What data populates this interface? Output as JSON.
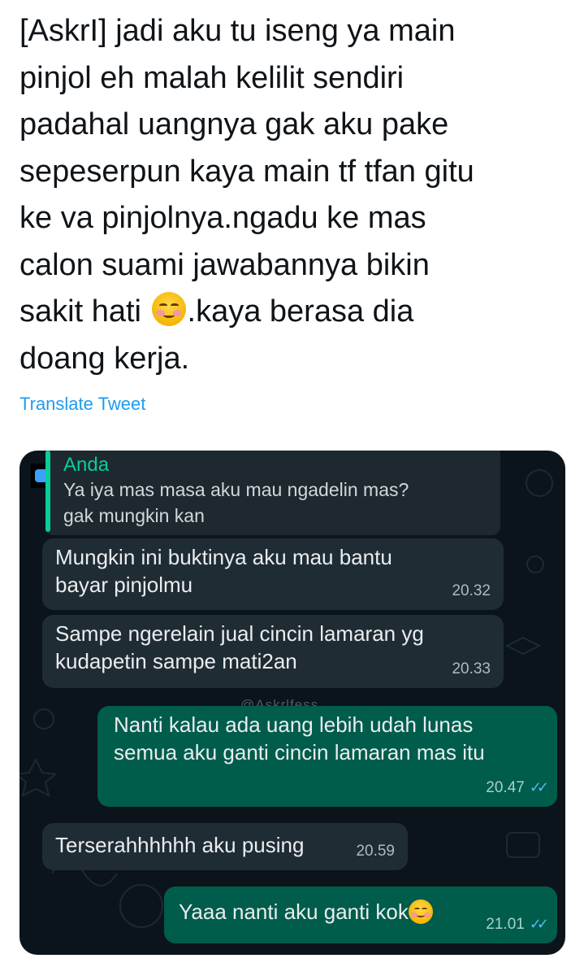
{
  "tweet": {
    "text_part1": "[AskrI] jadi aku tu iseng ya main\npinjol eh malah kelilit sendiri\npadahal uangnya gak aku pake\nsepeserpun kaya main tf tfan gitu\nke va pinjolnya.ngadu ke mas\ncalon suami jawabannya bikin\nsakit hati ",
    "emoji": "smiling-face-with-blush",
    "text_part2": ".kaya berasa dia\ndoang kerja.",
    "translate_label": "Translate Tweet"
  },
  "chat": {
    "quoted": {
      "sender": "Anda",
      "message": "Ya iya mas masa aku mau ngadelin mas?\ngak mungkin kan"
    },
    "watermark": "@Askrlfess",
    "messages": [
      {
        "direction": "incoming",
        "text": "Mungkin ini buktinya aku mau bantu\nbayar pinjolmu",
        "time": "20.32"
      },
      {
        "direction": "incoming",
        "text": "Sampe ngerelain jual cincin lamaran yg\nkudapetin sampe mati2an",
        "time": "20.33"
      },
      {
        "direction": "outgoing",
        "text": "Nanti kalau ada uang lebih udah lunas\nsemua aku ganti cincin lamaran mas itu",
        "time": "20.47",
        "status": "read"
      },
      {
        "direction": "incoming",
        "text": "Terserahhhhhh aku pusing",
        "time": "20.59"
      },
      {
        "direction": "outgoing",
        "text": "Yaaa nanti aku ganti kok",
        "emoji": "smiling-face-with-blush",
        "time": "21.01",
        "status": "read"
      }
    ],
    "colors": {
      "background": "#0b141a",
      "incoming_bubble": "#202c33",
      "outgoing_bubble": "#005c4b",
      "accent": "#06cf9c",
      "read_ticks": "#53bdeb"
    }
  }
}
